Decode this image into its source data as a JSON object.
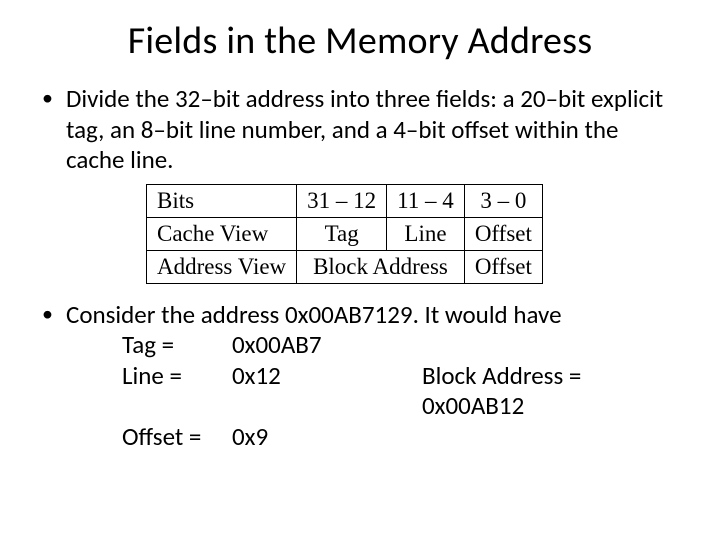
{
  "title": "Fields in the Memory Address",
  "bullet1": "Divide the 32–bit address into three fields: a 20–bit explicit tag, an 8–bit line number, and a 4–bit offset within the cache line.",
  "table": {
    "r0c0": "Bits",
    "r0c1": "31 – 12",
    "r0c2": "11 – 4",
    "r0c3": "3 – 0",
    "r1c0": "Cache View",
    "r1c1": "Tag",
    "r1c2": "Line",
    "r1c3": "Offset",
    "r2c0": "Address View",
    "r2c1_span": "Block Address",
    "r2c3": "Offset"
  },
  "bullet2_lead": "Consider the address 0x00AB7129. It would have",
  "example": {
    "tag_k": "Tag =",
    "tag_v": "0x00AB7",
    "line_k": "Line =",
    "line_v": "0x12",
    "block_label": "Block Address = 0x00AB12",
    "off_k": "Offset =",
    "off_v": "0x9"
  }
}
